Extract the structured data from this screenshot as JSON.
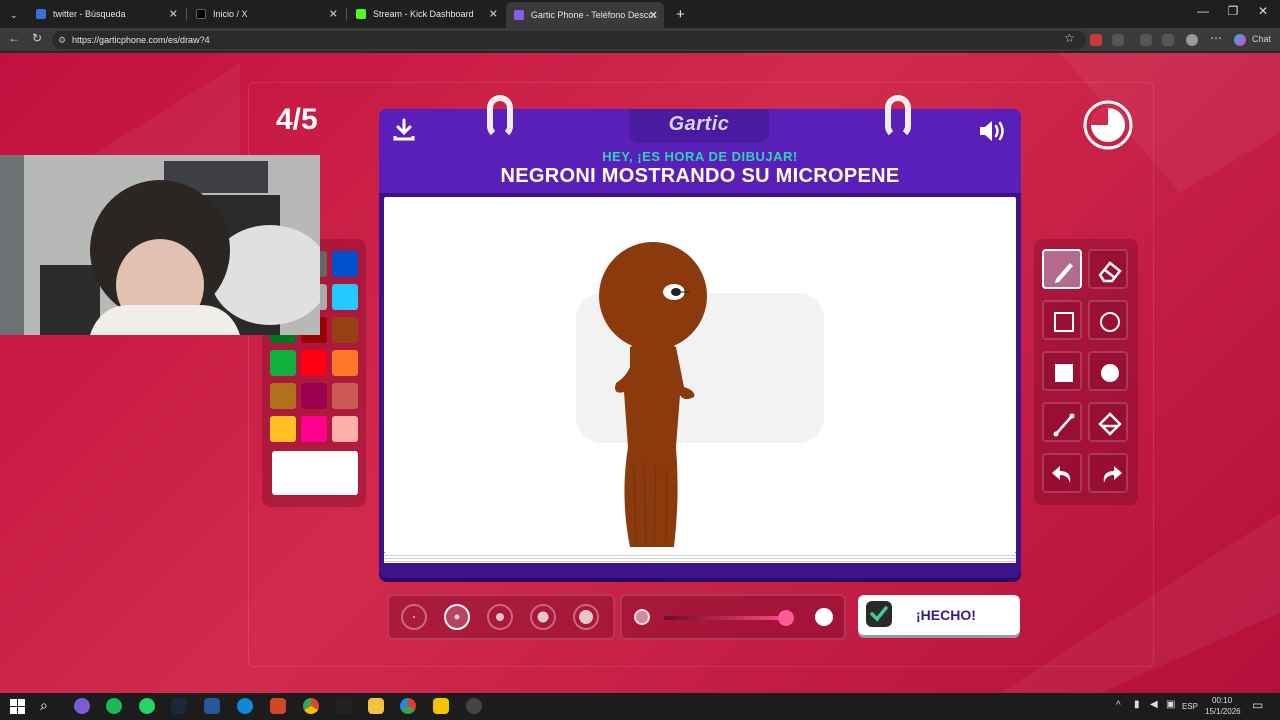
{
  "browser": {
    "tabs": [
      {
        "title": "twitter - Búsqueda",
        "active": false
      },
      {
        "title": "Inicio / X",
        "active": false
      },
      {
        "title": "Stream - Kick Dashboard",
        "active": false
      },
      {
        "title": "Gartic Phone - Teléfono Descomp",
        "active": true
      }
    ],
    "new_tab_label": "+",
    "url": "https://garticphone.com/es/draw?4",
    "chat_label": "Chat"
  },
  "game": {
    "round": "4/5",
    "logo": "Gartic",
    "hint": "HEY, ¡ES HORA DE DIBUJAR!",
    "prompt": "NEGRONI MOSTRANDO SU MICROPENE",
    "done_label": "¡HECHO!",
    "selected_color": "#ffffff",
    "stroke_color": "#8b3a0e",
    "palette": [
      "#000000",
      "#666666",
      "#0050cd",
      "#ffffff",
      "#aaaaaa",
      "#26c9ff",
      "#017420",
      "#990000",
      "#964112",
      "#11b03c",
      "#ff0013",
      "#ff7829",
      "#b0701c",
      "#99004e",
      "#cb5a57",
      "#ffc126",
      "#ff008f",
      "#feafa8"
    ],
    "tools": [
      "pencil-tool",
      "eraser-tool",
      "rectangle-outline-tool",
      "ellipse-outline-tool",
      "rectangle-fill-tool",
      "ellipse-fill-tool",
      "line-tool",
      "bucket-tool",
      "undo-tool",
      "redo-tool"
    ],
    "selected_tool": "pencil-tool",
    "brush_sizes": 5,
    "selected_brush_size": 2,
    "opacity": 1.0
  },
  "taskbar": {
    "lang": "ESP",
    "time": "00:10",
    "date": "15/1/2026"
  }
}
